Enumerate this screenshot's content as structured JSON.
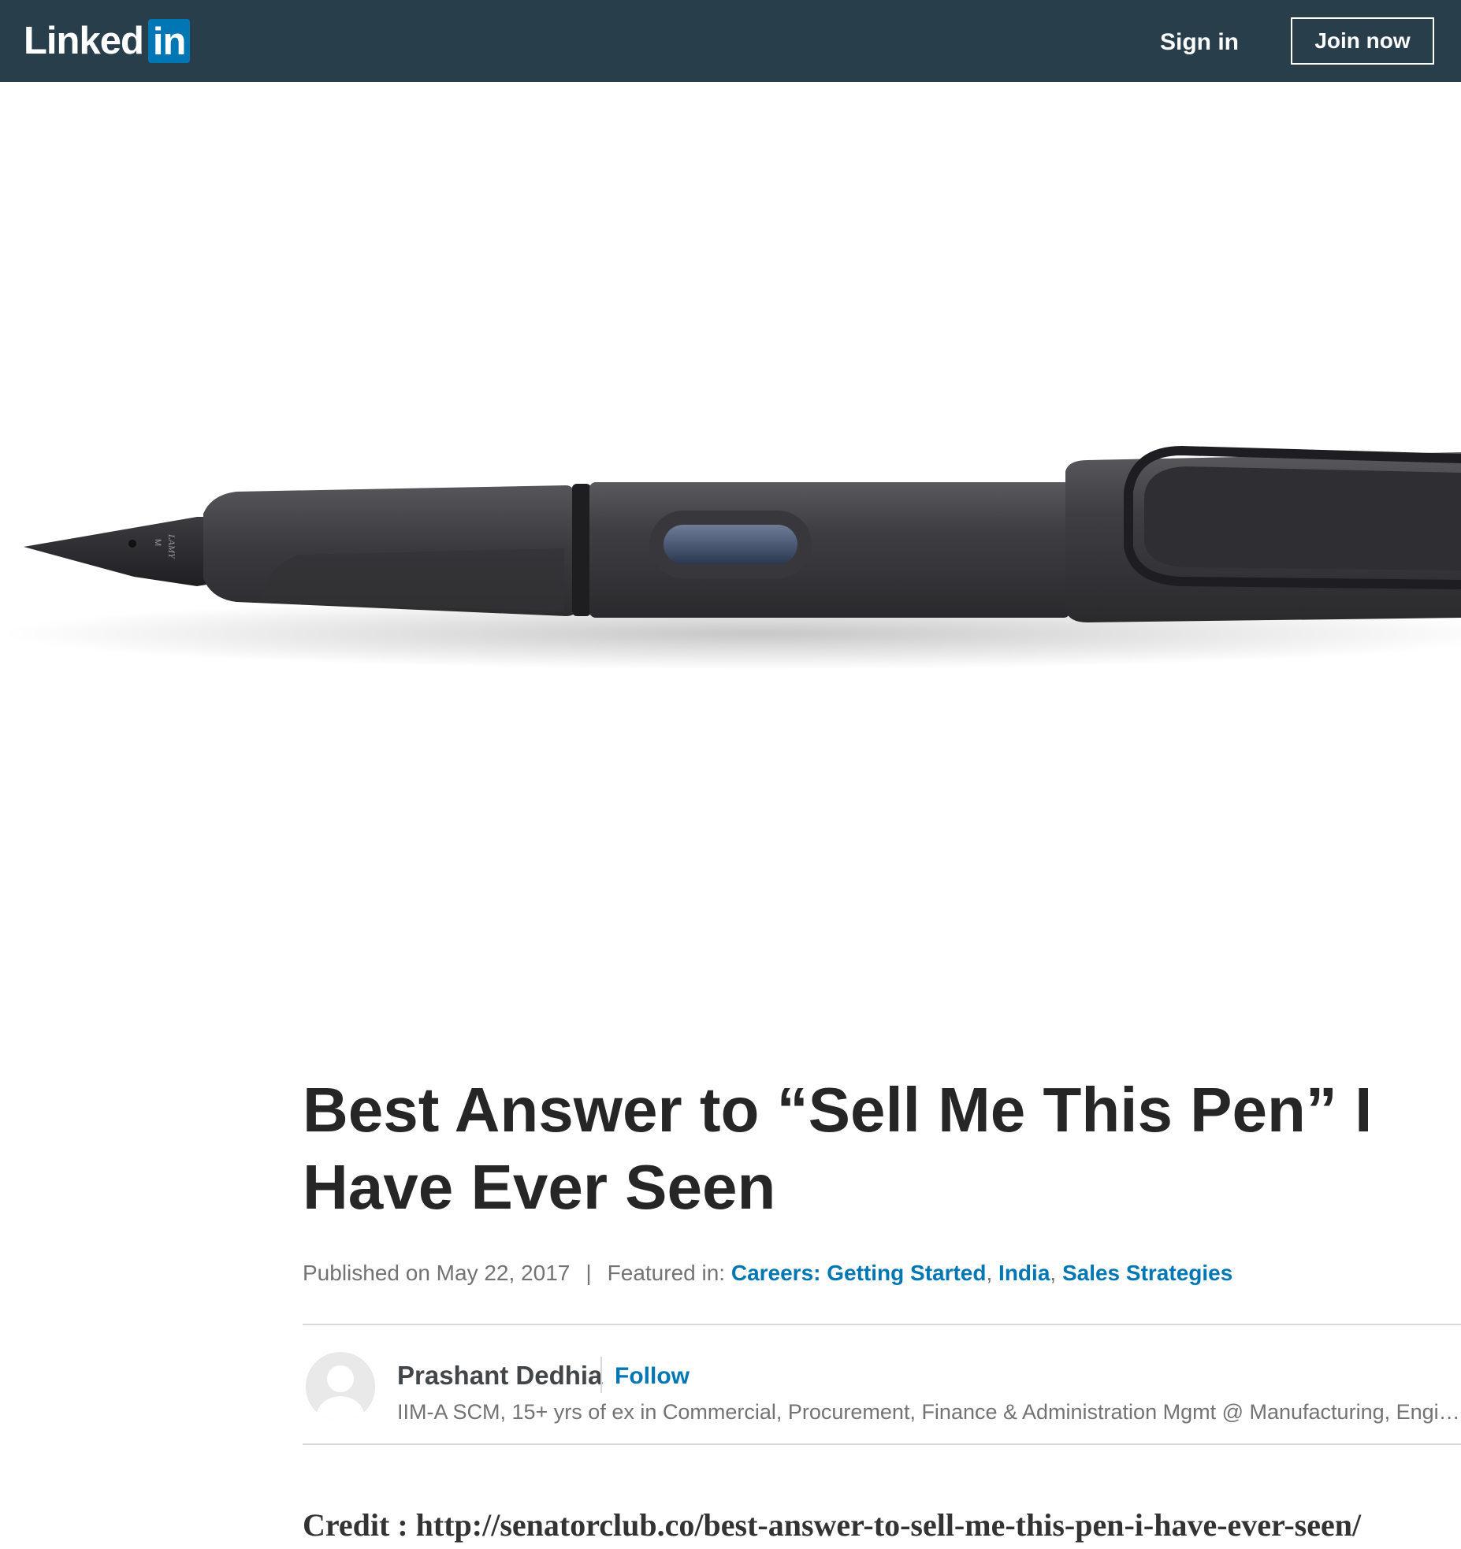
{
  "header": {
    "logo_word": "Linked",
    "logo_box": "in",
    "sign_in": "Sign in",
    "join_now": "Join now",
    "background_color": "#283e4a",
    "brand_color": "#0077b5"
  },
  "hero": {
    "image": "fountain-pen-photo",
    "nib_imprint_letter": "M",
    "nib_imprint_brand": "LAMY"
  },
  "article": {
    "title": "Best Answer to “Sell Me This Pen” I Have Ever Seen",
    "published": "Published on May 22, 2017",
    "separator": "|",
    "featured_label": "Featured in:",
    "featured": [
      "Careers: Getting Started",
      "India",
      "Sales Strategies"
    ],
    "featured_comma": ",",
    "author": {
      "name": "Prashant Dedhia",
      "follow": "Follow",
      "headline": "IIM-A SCM, 15+ yrs of ex in Commercial, Procurement, Finance & Administration Mgmt @ Manufacturing, Engineering & Infrastructure"
    },
    "body_first_line": "Credit : http://senatorclub.co/best-answer-to-sell-me-this-pen-i-have-ever-seen/"
  }
}
